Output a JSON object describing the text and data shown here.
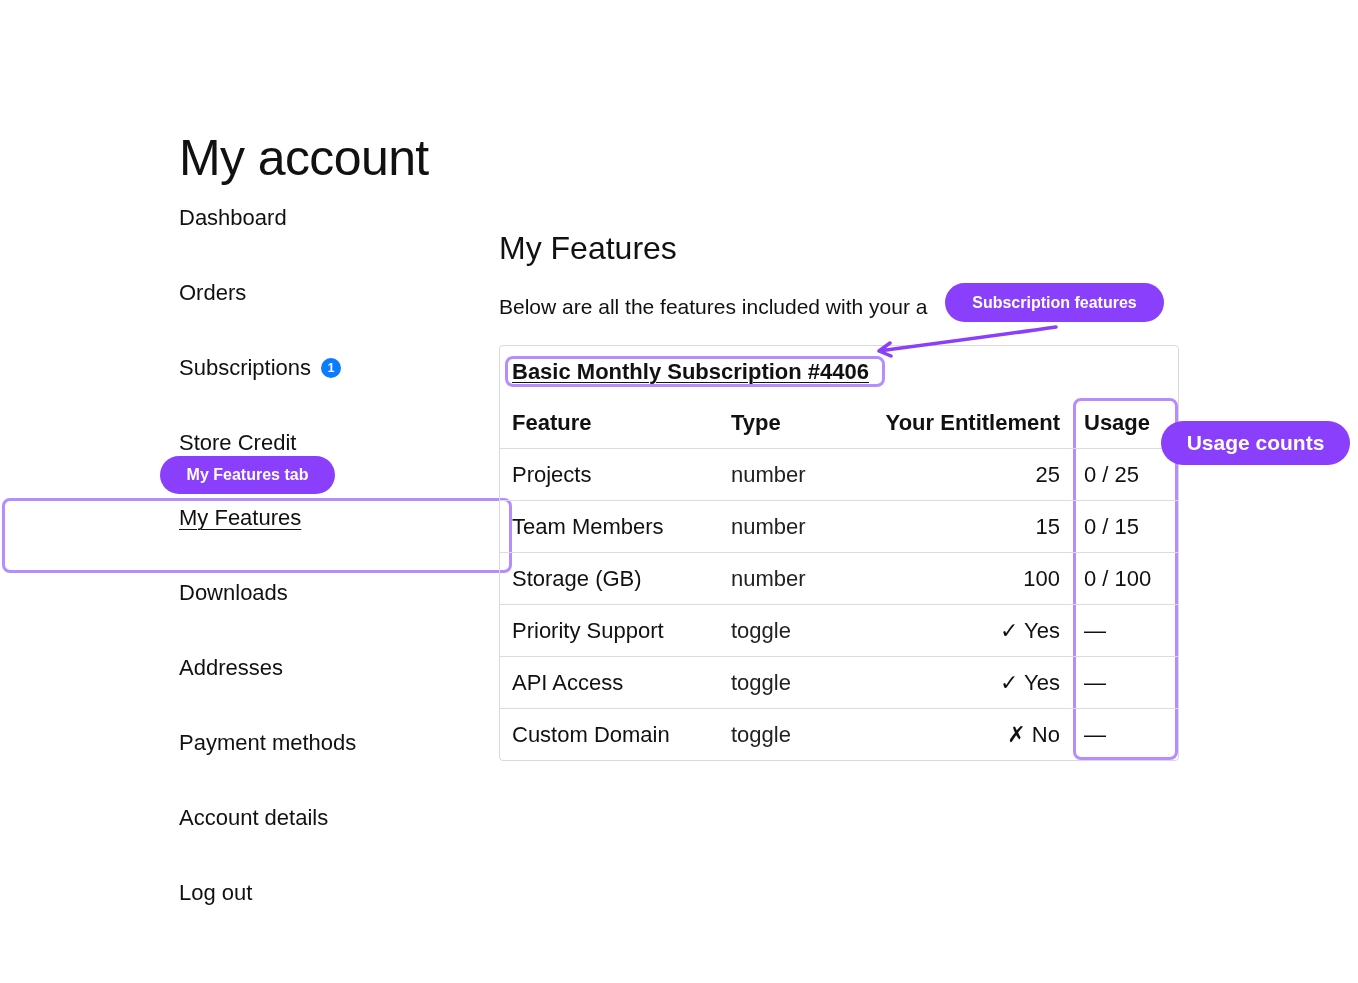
{
  "page_title": "My account",
  "sidebar": {
    "items": [
      {
        "label": "Dashboard",
        "selected": false
      },
      {
        "label": "Orders",
        "selected": false
      },
      {
        "label": "Subscriptions",
        "selected": false,
        "badge": "1"
      },
      {
        "label": "Store Credit",
        "selected": false
      },
      {
        "label": "My Features",
        "selected": true
      },
      {
        "label": "Downloads",
        "selected": false
      },
      {
        "label": "Addresses",
        "selected": false
      },
      {
        "label": "Payment methods",
        "selected": false
      },
      {
        "label": "Account details",
        "selected": false
      },
      {
        "label": "Log out",
        "selected": false
      }
    ]
  },
  "content": {
    "title": "My Features",
    "description": "Below are all the features included with your a",
    "subscription": {
      "title": "Basic Monthly Subscription #4406",
      "table": {
        "columns": [
          "Feature",
          "Type",
          "Your Entitlement",
          "Usage"
        ],
        "rows": [
          {
            "feature": "Projects",
            "type": "number",
            "entitlement": "25",
            "usage": "0 / 25"
          },
          {
            "feature": "Team Members",
            "type": "number",
            "entitlement": "15",
            "usage": "0 / 15"
          },
          {
            "feature": "Storage (GB)",
            "type": "number",
            "entitlement": "100",
            "usage": "0 / 100"
          },
          {
            "feature": "Priority Support",
            "type": "toggle",
            "entitlement": "✓ Yes",
            "usage": "—"
          },
          {
            "feature": "API Access",
            "type": "toggle",
            "entitlement": "✓ Yes",
            "usage": "—"
          },
          {
            "feature": "Custom Domain",
            "type": "toggle",
            "entitlement": "✗ No",
            "usage": "—"
          }
        ]
      }
    }
  },
  "annotations": [
    {
      "kind": "nav-item",
      "label": "My Features tab"
    },
    {
      "kind": "subscription-title",
      "label": "Subscription features"
    },
    {
      "kind": "usage-column",
      "label": "Usage counts"
    }
  ]
}
